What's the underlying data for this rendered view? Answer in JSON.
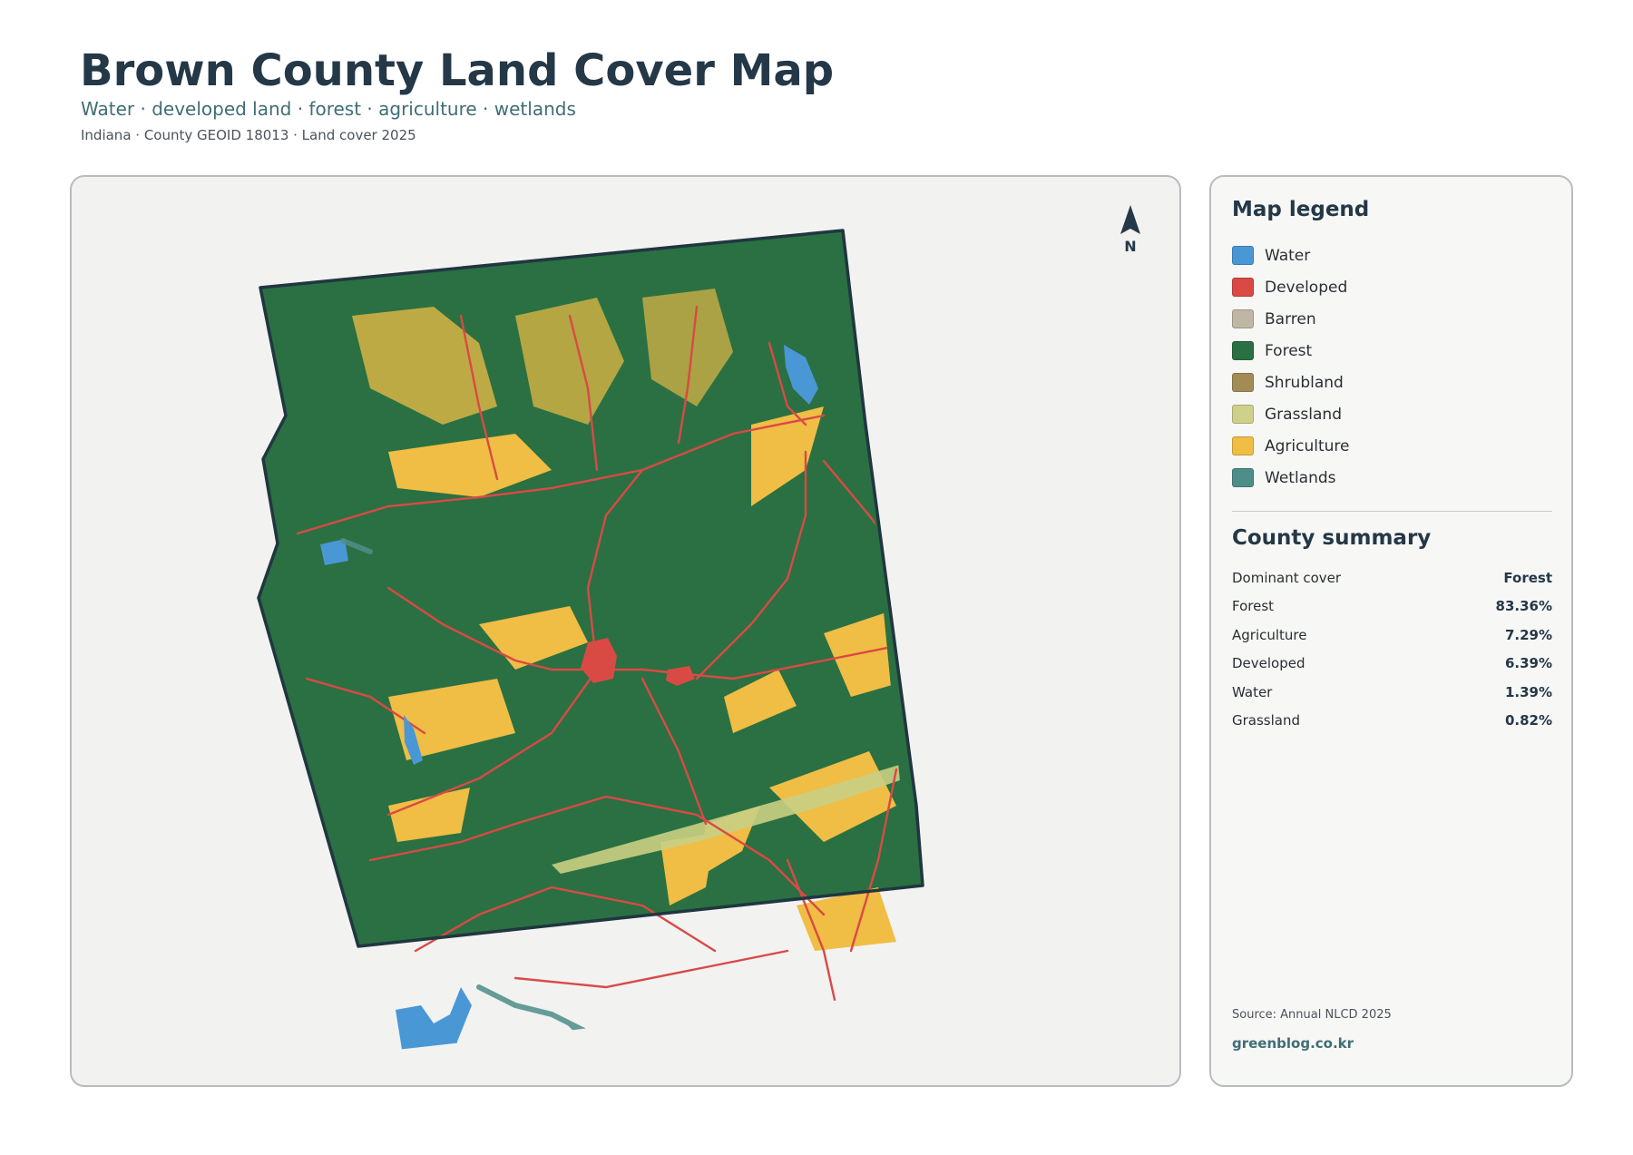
{
  "header": {
    "title": "Brown County Land Cover Map",
    "subtitle": "Water · developed land · forest · agriculture · wetlands",
    "meta": "Indiana · County GEOID 18013 · Land cover 2025"
  },
  "map": {
    "north_label": "N",
    "colors": {
      "water": "#4a97d6",
      "developed": "#d94a45",
      "forest": "#2a7042",
      "agriculture": "#f0bd45",
      "grassland": "#c9cf83",
      "wetlands": "#4d8e89",
      "outline": "#203640",
      "background": "#f2f2f1"
    }
  },
  "legend": {
    "title": "Map legend",
    "items": [
      {
        "label": "Water",
        "color": "#4a97d6"
      },
      {
        "label": "Developed",
        "color": "#d94a45"
      },
      {
        "label": "Barren",
        "color": "#bfb7a4"
      },
      {
        "label": "Forest",
        "color": "#2a7042"
      },
      {
        "label": "Shrubland",
        "color": "#a38b55"
      },
      {
        "label": "Grassland",
        "color": "#cdd18a"
      },
      {
        "label": "Agriculture",
        "color": "#f0bd45"
      },
      {
        "label": "Wetlands",
        "color": "#4d8e89"
      }
    ]
  },
  "summary": {
    "title": "County summary",
    "rows": [
      {
        "label": "Dominant cover",
        "value": "Forest"
      },
      {
        "label": "Forest",
        "value": "83.36%"
      },
      {
        "label": "Agriculture",
        "value": "7.29%"
      },
      {
        "label": "Developed",
        "value": "6.39%"
      },
      {
        "label": "Water",
        "value": "1.39%"
      },
      {
        "label": "Grassland",
        "value": "0.82%"
      }
    ]
  },
  "footer": {
    "source": "Source: Annual NLCD 2025",
    "site": "greenblog.co.kr"
  }
}
